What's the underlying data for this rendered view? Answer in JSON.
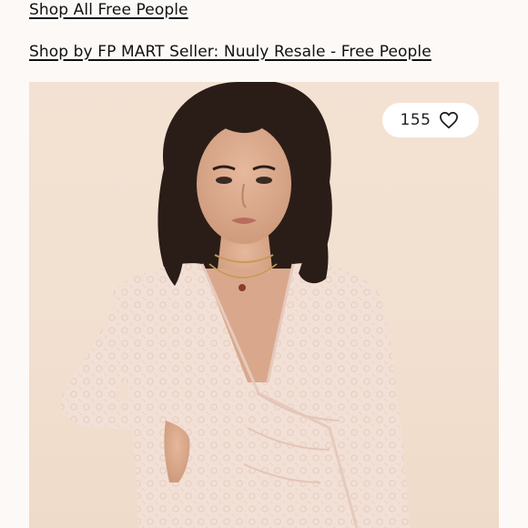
{
  "links": {
    "shop_all": "Shop All Free People",
    "shop_by_seller": "Shop by FP MART Seller: Nuuly Resale - Free People"
  },
  "listing_image": {
    "alt": "Woman wearing a blush lace long-sleeve wrap top"
  },
  "likes": {
    "count": "155",
    "icon": "heart-outline-icon"
  },
  "colors": {
    "background": "#fdf9f7",
    "photo_backdrop": "#f3e2d3",
    "top_lace": "#f1ddd1",
    "hair": "#2a1d17"
  }
}
